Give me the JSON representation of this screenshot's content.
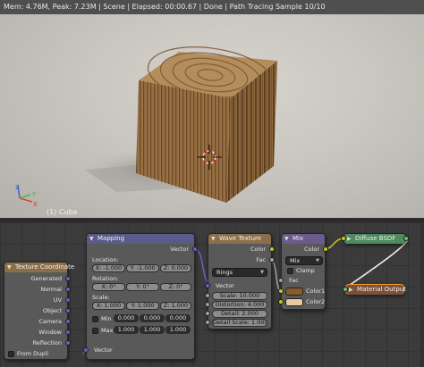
{
  "status": {
    "text": "Mem: 4.76M, Peak: 7.23M | Scene | Elapsed: 00:00.67 | Done | Path Tracing Sample 10/10"
  },
  "viewport": {
    "object_label": "(1) Cube",
    "axis_labels": {
      "x": "X",
      "y": "Y",
      "z": "Z"
    }
  },
  "nodes": {
    "texcoord": {
      "title": "Texture Coordinate",
      "outputs": [
        "Generated",
        "Normal",
        "UV",
        "Object",
        "Camera",
        "Window",
        "Reflection"
      ],
      "from_dupli": "From Dupli"
    },
    "mapping": {
      "title": "Mapping",
      "output": "Vector",
      "location_label": "Location:",
      "location": [
        "X: -1.000",
        "Y: -1.000",
        "Z: 0.000"
      ],
      "rotation_label": "Rotation:",
      "rotation": [
        "X: 0°",
        "Y: 0°",
        "Z: 0°"
      ],
      "scale_label": "Scale:",
      "scale": [
        "X: 1.000",
        "Y: 1.000",
        "Z: 1.000"
      ],
      "min_label": "Min",
      "min": [
        "0.000",
        "0.000",
        "0.000"
      ],
      "max_label": "Max",
      "max": [
        "1.000",
        "1.000",
        "1.000"
      ],
      "input": "Vector"
    },
    "wave": {
      "title": "Wave Texture",
      "outputs": [
        "Color",
        "Fac"
      ],
      "type": "Rings",
      "vector_label": "Vector",
      "fields": [
        "Scale: 10.000",
        "Distortion: 4.000",
        "Detail: 2.000",
        "Detail Scale: 1.000"
      ]
    },
    "mix": {
      "title": "Mix",
      "output": "Color",
      "blend": "Mix",
      "clamp": "Clamp",
      "fac": "Fac",
      "color1": "Color1",
      "color2": "Color2",
      "color1_value": "#8a5a2b",
      "color2_value": "#e8c9a0"
    },
    "diffuse": {
      "title": "Diffuse BSDF"
    },
    "output": {
      "title": "Material Output"
    }
  },
  "colors": {
    "wood_dark": "#6d4a26",
    "wood_light": "#b08a5a",
    "socket_vector": "#6363c7",
    "socket_color": "#c7c729",
    "socket_shader": "#63c763"
  }
}
